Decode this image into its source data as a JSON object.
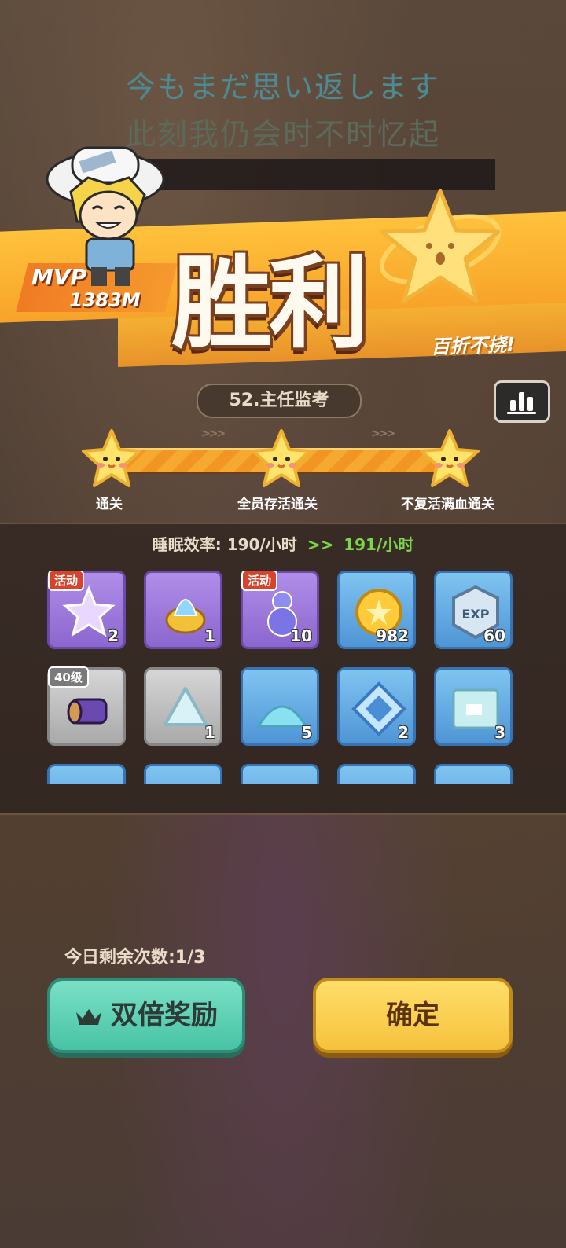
{
  "lyrics": {
    "line1": "今もまだ思い返します",
    "line2": "此刻我仍会时不时忆起"
  },
  "result": {
    "title": "胜利",
    "slogan": "百折不挠!",
    "mvp_label": "MVP",
    "mvp_value": "1383M"
  },
  "stage": {
    "name": "52.主任监考"
  },
  "objectives": [
    {
      "label": "通关",
      "achieved": true
    },
    {
      "label": "全员存活通关",
      "achieved": true
    },
    {
      "label": "不复活满血通关",
      "achieved": true
    }
  ],
  "efficiency": {
    "label": "睡眠效率:",
    "old": "190/小时",
    "arrow": ">>",
    "new": "191/小时"
  },
  "rewards": [
    {
      "icon": "rainbow-star-potion-icon",
      "rarity": "purple",
      "qty": "2",
      "tag": "活动"
    },
    {
      "icon": "blue-flame-orb-icon",
      "rarity": "purple",
      "qty": "1",
      "tag": ""
    },
    {
      "icon": "gourd-potion-icon",
      "rarity": "purple",
      "qty": "10",
      "tag": "活动"
    },
    {
      "icon": "gold-coin-icon",
      "rarity": "blue",
      "qty": "982",
      "tag": ""
    },
    {
      "icon": "exp-badge-icon",
      "rarity": "blue",
      "qty": "60",
      "tag": ""
    },
    {
      "icon": "purple-drum-icon",
      "rarity": "gray",
      "qty": "",
      "tag": "40级"
    },
    {
      "icon": "crystal-triangle-icon",
      "rarity": "gray",
      "qty": "1",
      "tag": ""
    },
    {
      "icon": "blue-sand-pile-icon",
      "rarity": "blue",
      "qty": "5",
      "tag": ""
    },
    {
      "icon": "blue-gem-tile-icon",
      "rarity": "blue",
      "qty": "2",
      "tag": ""
    },
    {
      "icon": "map-scroll-icon",
      "rarity": "blue",
      "qty": "3",
      "tag": ""
    },
    {
      "icon": "item-partial-icon",
      "rarity": "blue",
      "qty": "",
      "tag": ""
    },
    {
      "icon": "item-partial-icon",
      "rarity": "blue",
      "qty": "",
      "tag": ""
    },
    {
      "icon": "item-partial-icon",
      "rarity": "blue",
      "qty": "",
      "tag": ""
    },
    {
      "icon": "item-partial-icon",
      "rarity": "blue",
      "qty": "",
      "tag": ""
    },
    {
      "icon": "item-partial-icon",
      "rarity": "blue",
      "qty": "",
      "tag": ""
    }
  ],
  "footer": {
    "remaining": "今日剩余次数:1/3",
    "double_reward": "双倍奖励",
    "confirm": "确定"
  },
  "colors": {
    "banner": "#ffc23c",
    "accent_green": "#7bd64a",
    "double_btn": "#48c3a4",
    "confirm_btn": "#f6c23c"
  }
}
